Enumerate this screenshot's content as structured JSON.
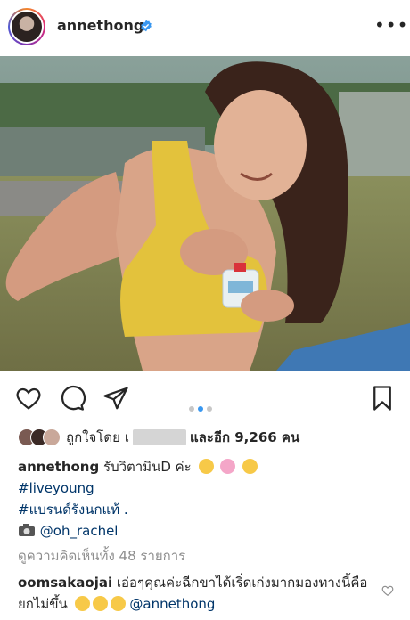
{
  "header": {
    "username": "annethong",
    "avatar_icon": "avatar",
    "verified_icon": "verified-badge-icon",
    "more_label": "•••"
  },
  "colors": {
    "verified": "#3897f0",
    "link": "#003569",
    "muted": "#8e8e8e",
    "active_dot": "#3897f0"
  },
  "actions": {
    "icons": [
      "heart-icon",
      "comment-icon",
      "share-icon",
      "bookmark-icon"
    ],
    "carousel_pages": 3,
    "carousel_active": 2
  },
  "likes": {
    "prefix": "ถูกใจโดย",
    "initial": "เ",
    "suffix": "และอีก 9,266 คน"
  },
  "caption": {
    "username": "annethong",
    "text": "รับวิตามินD ค่ะ",
    "hashtag1": "#liveyoung",
    "hashtag2": "#แบรนด์รังนกแท้ .",
    "credit": "@oh_rachel"
  },
  "comments_link": "ดูความคิดเห็นทั้ง 48 รายการ",
  "comment": {
    "username": "oomsakaojai",
    "text": "เอ่อๆคุณค่ะฉีกขาได้เริ่ดเก่งมากมองทางนี้คือยกไม่ขึ้น",
    "mention": "@annethong"
  }
}
